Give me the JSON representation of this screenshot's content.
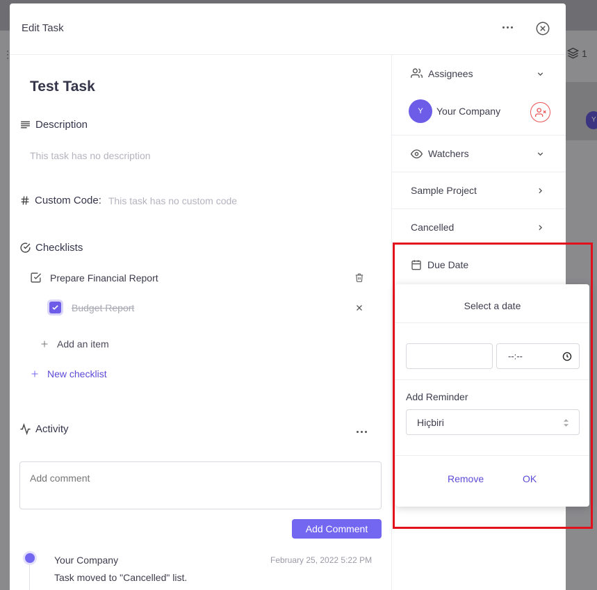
{
  "background": {
    "layers_count": "1",
    "avatar_initial": "Y"
  },
  "modal": {
    "title": "Edit Task",
    "more_icon": "more-horizontal-icon",
    "close_icon": "close-circle-icon"
  },
  "task": {
    "title": "Test Task",
    "description": {
      "heading": "Description",
      "text": "This task has no description"
    },
    "custom_code": {
      "heading": "Custom Code:",
      "text": "This task has no custom code"
    },
    "checklists": {
      "heading": "Checklists",
      "items": [
        {
          "label": "Prepare Financial Report",
          "checked": false,
          "action_icon": "trash-icon"
        },
        {
          "label": "Budget Report",
          "checked": true,
          "action_icon": "x-icon"
        }
      ],
      "add_item": "Add an item",
      "new_checklist": "New checklist"
    },
    "activity": {
      "heading": "Activity",
      "comment_placeholder": "Add comment",
      "add_comment": "Add Comment",
      "entries": [
        {
          "user": "Your Company",
          "date": "February 25, 2022 5:22 PM",
          "text": "Task moved to \"Cancelled\" list."
        }
      ]
    }
  },
  "sidebar": {
    "assignees": {
      "label": "Assignees",
      "user_initial": "Y",
      "user_name": "Your Company"
    },
    "watchers": {
      "label": "Watchers"
    },
    "project": {
      "label": "Sample Project"
    },
    "list": {
      "label": "Cancelled"
    },
    "due_date": {
      "label": "Due Date"
    }
  },
  "date_popover": {
    "title": "Select a date",
    "date_value": "",
    "time_placeholder": "--:--",
    "reminder_label": "Add Reminder",
    "reminder_value": "Hiçbiri",
    "remove_label": "Remove",
    "ok_label": "OK"
  },
  "colors": {
    "accent": "#7366f0",
    "danger": "#ea5455",
    "highlight": "#e1121c"
  }
}
